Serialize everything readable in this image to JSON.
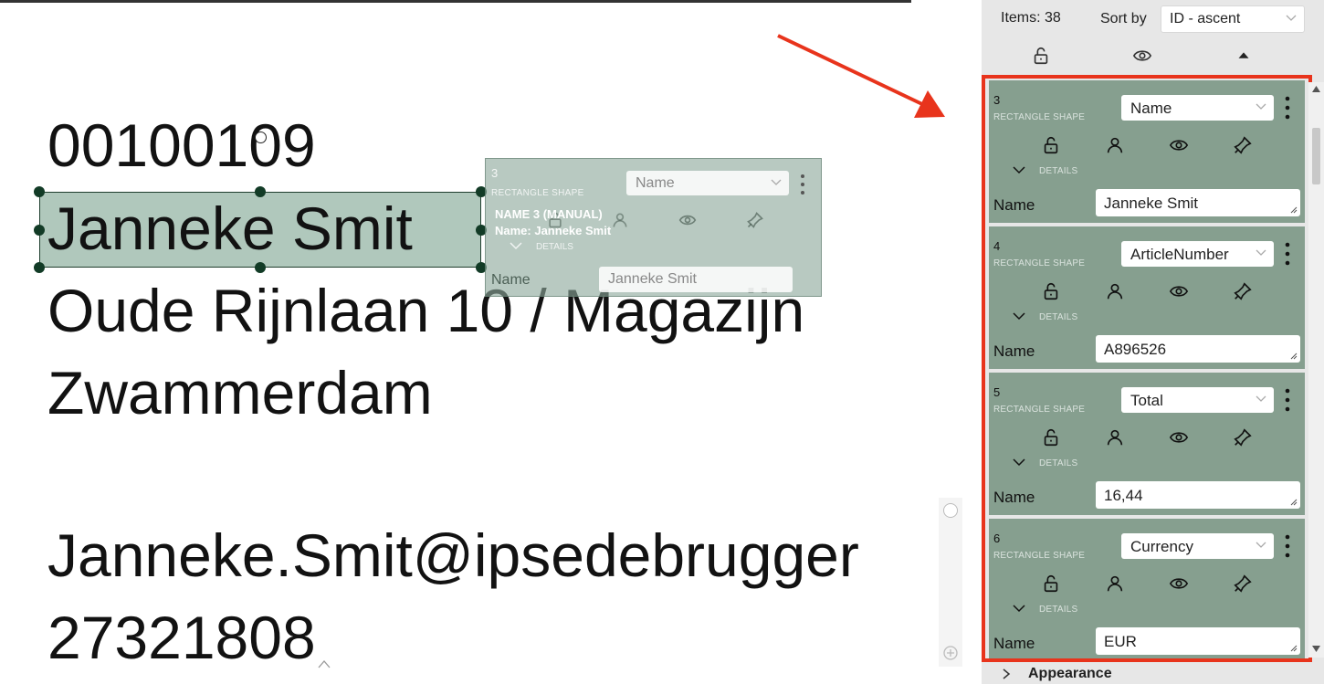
{
  "document": {
    "lines": [
      "00100109",
      "Janneke Smit",
      "Oude Rijnlaan 10 / Magazijn",
      "Zwammerdam",
      "Janneke.Smit@ipsedebrugger",
      "27321808"
    ]
  },
  "ghost_card": {
    "number": "3",
    "type": "RECTANGLE SHAPE",
    "field": "Name",
    "tooltip_title": "NAME 3 (MANUAL)",
    "tooltip_value": "Name: Janneke Smit",
    "details": "DETAILS",
    "name_label": "Name",
    "name_value": "Janneke Smit"
  },
  "panel": {
    "items_count": "Items: 38",
    "sort_label": "Sort by",
    "sort_value": "ID - ascent",
    "appearance": "Appearance",
    "items": [
      {
        "number": "3",
        "type": "RECTANGLE SHAPE",
        "field": "Name",
        "details": "DETAILS",
        "name_label": "Name",
        "value": "Janneke Smit"
      },
      {
        "number": "4",
        "type": "RECTANGLE SHAPE",
        "field": "ArticleNumber",
        "details": "DETAILS",
        "name_label": "Name",
        "value": "A896526"
      },
      {
        "number": "5",
        "type": "RECTANGLE SHAPE",
        "field": "Total",
        "details": "DETAILS",
        "name_label": "Name",
        "value": "16,44"
      },
      {
        "number": "6",
        "type": "RECTANGLE SHAPE",
        "field": "Currency",
        "details": "DETAILS",
        "name_label": "Name",
        "value": "EUR"
      }
    ]
  },
  "colors": {
    "highlight_frame": "#e8341c",
    "card_bg": "#869f8f",
    "selection_fill": "#96b6a5",
    "panel_bg": "#e7e7e7"
  },
  "icons": [
    "unlock-icon",
    "eye-icon",
    "triangle-up-icon",
    "user-icon",
    "pin-icon",
    "more-vertical-icon",
    "chevron-down-icon",
    "chevron-right-icon",
    "resize-grip-icon"
  ]
}
